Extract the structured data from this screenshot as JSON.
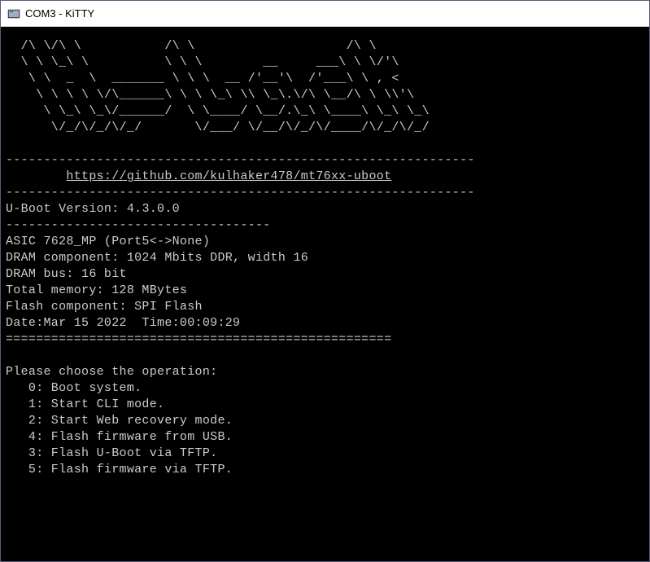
{
  "window": {
    "title": "COM3 - KiTTY"
  },
  "terminal": {
    "ascii_art": "  /\\ \\/\\ \\           /\\ \\                    /\\ \\\n  \\ \\ \\_\\ \\          \\ \\ \\        __     ___\\ \\ \\/'\\\n   \\ \\  _  \\  _______ \\ \\ \\  __ /'__'\\  /'___\\ \\ , <\n    \\ \\ \\ \\ \\/\\______\\ \\ \\ \\_\\ \\\\ \\_\\.\\/\\ \\__/\\ \\ \\\\'\\\n     \\ \\_\\ \\_\\/______/  \\ \\____/ \\__/.\\_\\ \\____\\ \\_\\ \\_\\\n      \\/_/\\/_/\\/_/       \\/___/ \\/__/\\/_/\\/____/\\/_/\\/_/",
    "divider1": "--------------------------------------------------------------",
    "link_prefix": "        ",
    "link_url": "https://github.com/kulhaker478/mt76xx-uboot",
    "divider2": "--------------------------------------------------------------",
    "uboot_version_label": "U-Boot Version:",
    "uboot_version": "4.3.0.0",
    "divider3": "-----------------------------------",
    "asic": "ASIC 7628_MP (Port5<->None)",
    "dram_component": "DRAM component: 1024 Mbits DDR, width 16",
    "dram_bus": "DRAM bus: 16 bit",
    "total_memory": "Total memory: 128 MBytes",
    "flash_component": "Flash component: SPI Flash",
    "datetime": "Date:Mar 15 2022  Time:00:09:29",
    "divider4": "===================================================",
    "prompt": "Please choose the operation:",
    "options": [
      {
        "num": "0",
        "label": "Boot system."
      },
      {
        "num": "1",
        "label": "Start CLI mode."
      },
      {
        "num": "2",
        "label": "Start Web recovery mode."
      },
      {
        "num": "4",
        "label": "Flash firmware from USB."
      },
      {
        "num": "3",
        "label": "Flash U-Boot via TFTP."
      },
      {
        "num": "5",
        "label": "Flash firmware via TFTP."
      }
    ]
  }
}
